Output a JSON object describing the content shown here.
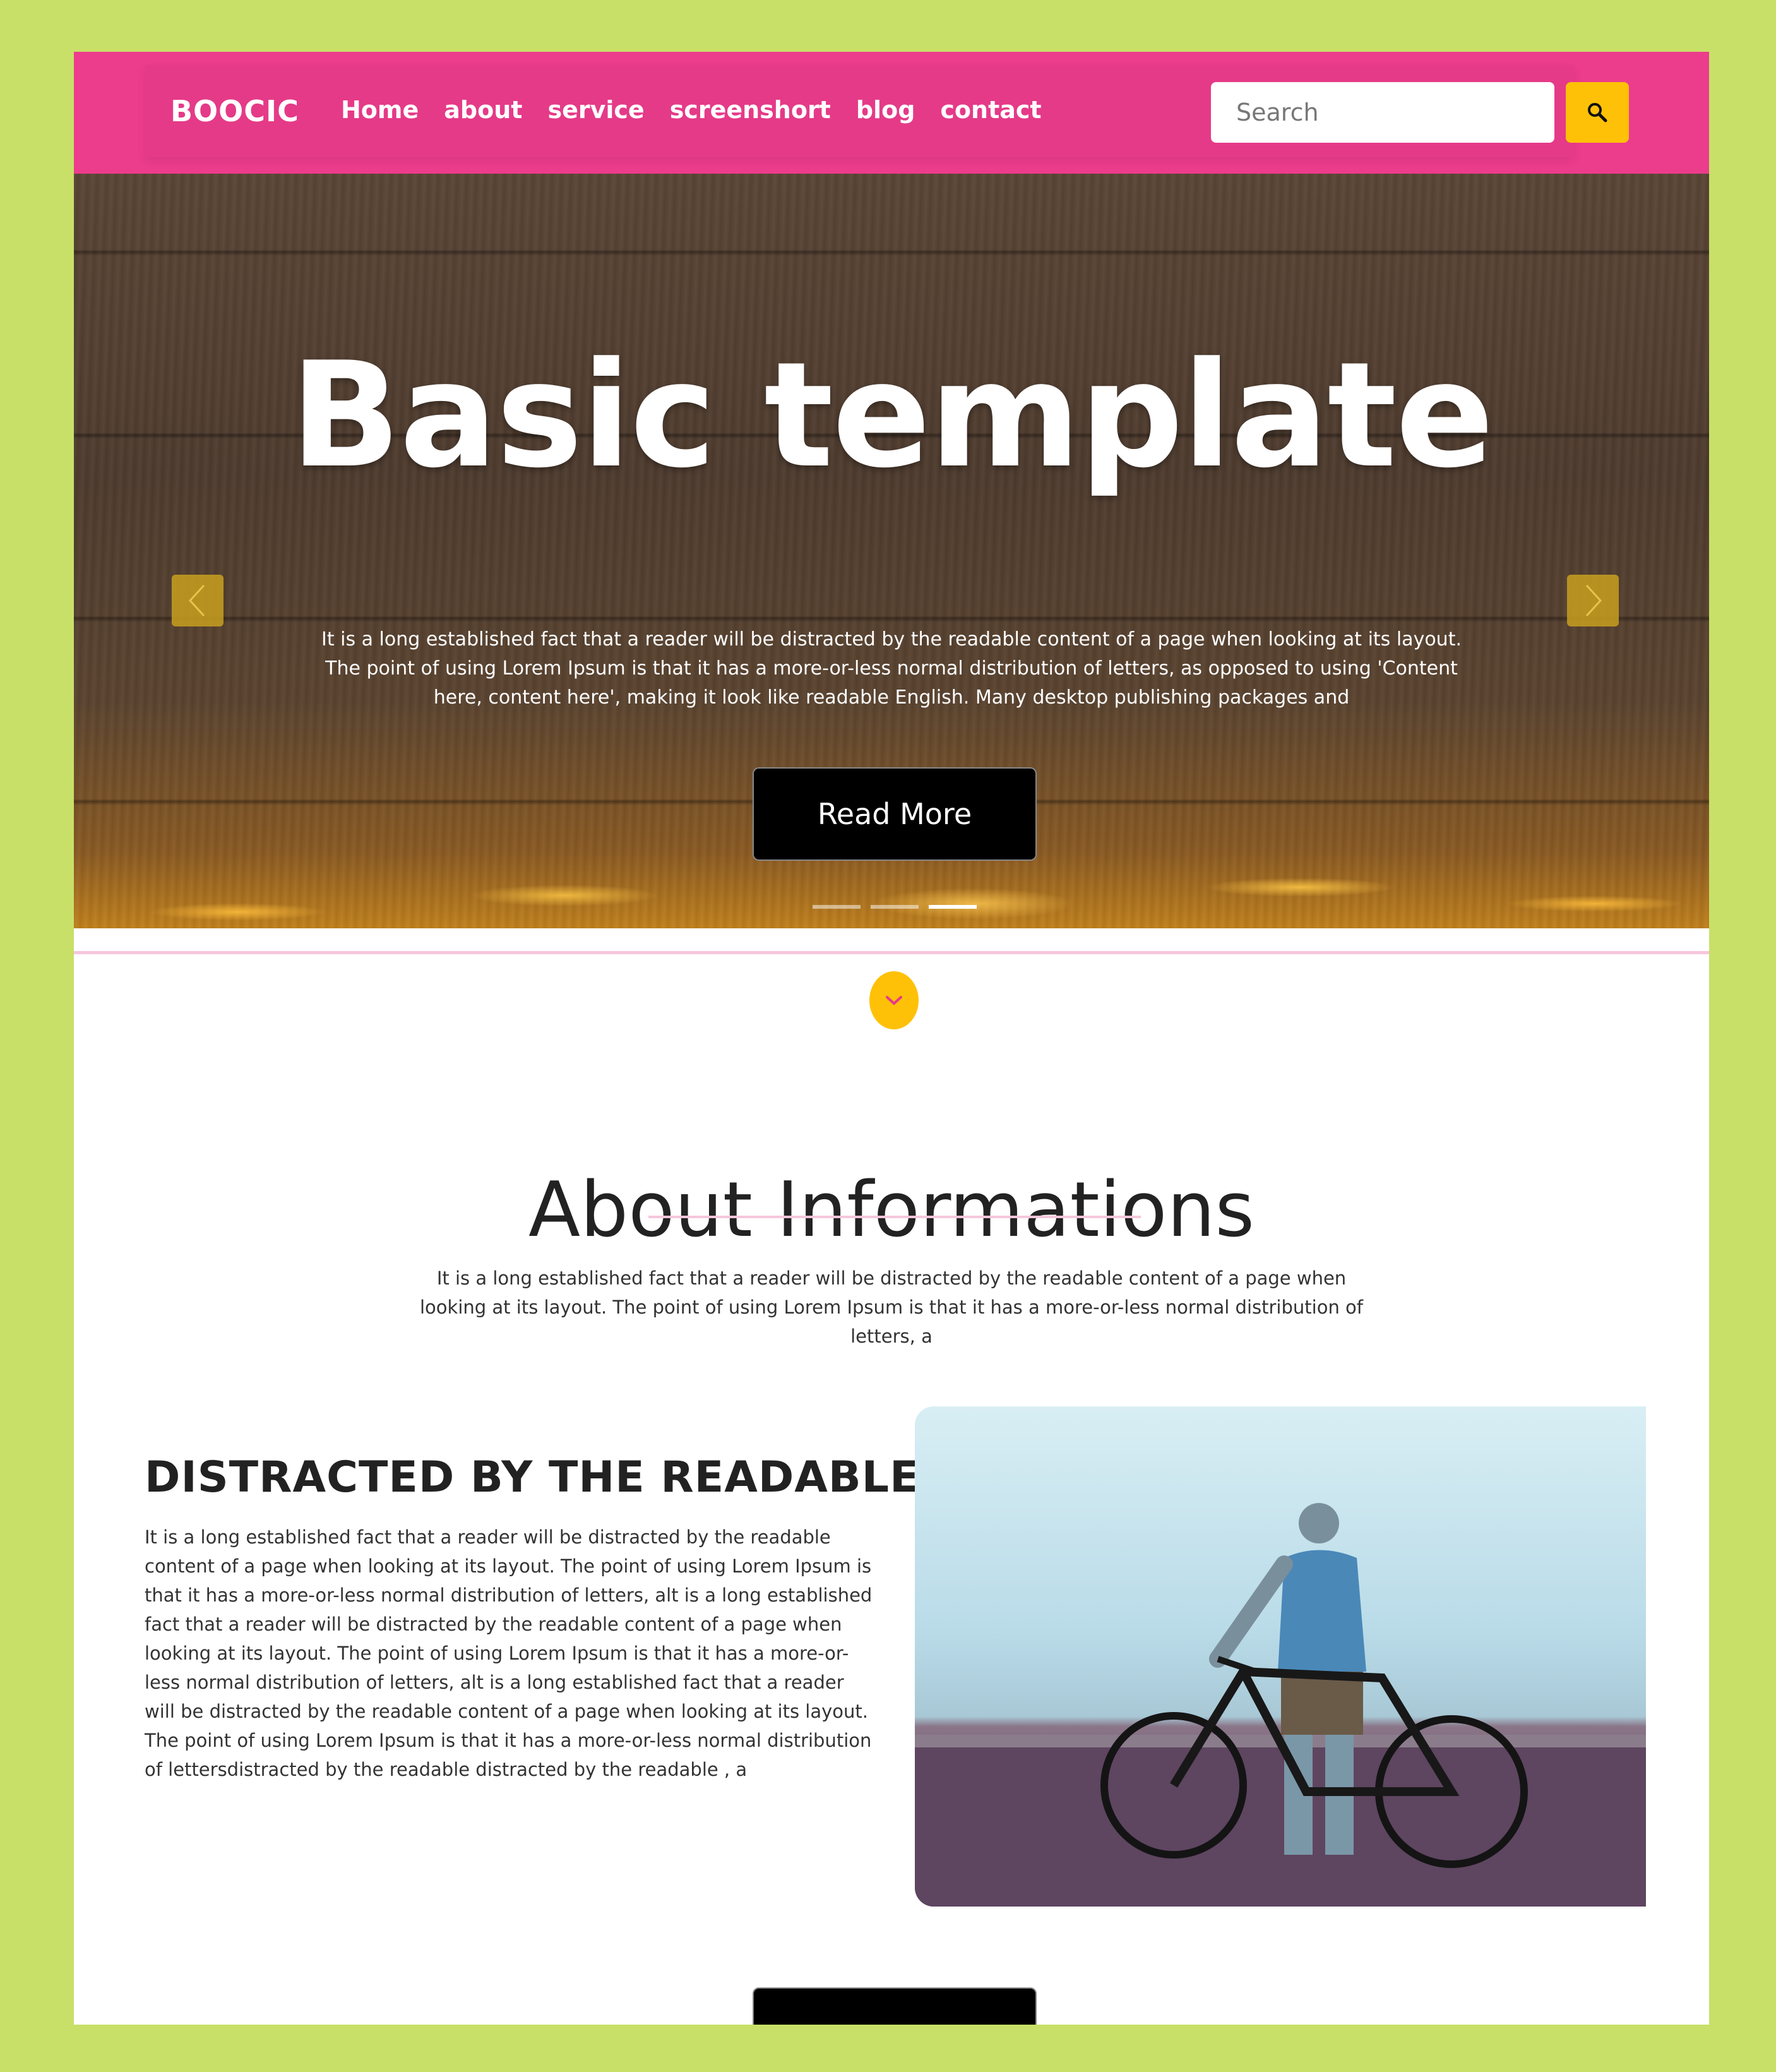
{
  "header": {
    "brand": "BOOCIC",
    "nav": [
      "Home",
      "about",
      "service",
      "screenshort",
      "blog",
      "contact"
    ],
    "search_placeholder": "Search",
    "search_icon": "search-icon"
  },
  "hero": {
    "title": "Basic template",
    "text": "It is a long established fact that a reader will be distracted by the readable content of a page when looking at its layout. The point of using Lorem Ipsum is that it has a more-or-less normal distribution of letters, as opposed to using 'Content here, content here', making it look like readable English. Many desktop publishing packages and",
    "button": "Read More",
    "slides_count": 3,
    "active_slide": 3
  },
  "about": {
    "title": "About Informations",
    "text": "It is a long established fact that a reader will be distracted by the readable content of a page when looking at its layout. The point of using Lorem Ipsum is that it has a more-or-less normal distribution of letters, a"
  },
  "feature": {
    "heading": "DISTRACTED BY THE READABLE",
    "text": "It is a long established fact that a reader will be distracted by the readable content of a page when looking at its layout. The point of using Lorem Ipsum is that it has a more-or-less normal distribution of letters, alt is a long established fact that a reader will be distracted by the readable content of a page when looking at its layout. The point of using Lorem Ipsum is that it has a more-or-less normal distribution of letters, alt is a long established fact that a reader will be distracted by the readable content of a page when looking at its layout. The point of using Lorem Ipsum is that it has a more-or-less normal distribution of lettersdistracted by the readable distracted by the readable , a"
  },
  "colors": {
    "background": "#c8e068",
    "header": "#ec3c8c",
    "accent": "#ffc107",
    "button": "#000000"
  }
}
